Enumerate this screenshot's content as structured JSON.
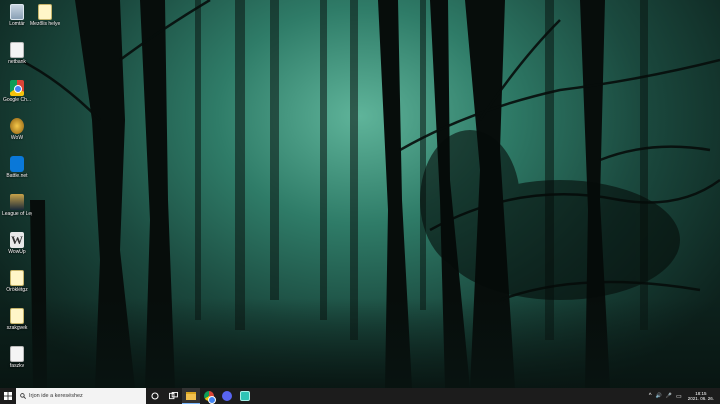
{
  "desktop": {
    "icons": [
      {
        "label": "Lomtár",
        "icon": "recycle-bin-icon"
      },
      {
        "label": "Mezőlis helye",
        "icon": "file-icon"
      },
      {
        "label": "netbank",
        "icon": "file-icon"
      },
      {
        "label": "Google Ch...",
        "icon": "chrome-icon"
      },
      {
        "label": "WoW",
        "icon": "wow-icon"
      },
      {
        "label": "Battle.net",
        "icon": "battlenet-icon"
      },
      {
        "label": "League of Legends",
        "icon": "league-icon"
      },
      {
        "label": "WowUp",
        "icon": "wowup-icon"
      },
      {
        "label": "Öröklétgz",
        "icon": "note-icon"
      },
      {
        "label": "szakgvek",
        "icon": "note-icon"
      },
      {
        "label": "faszkv",
        "icon": "file-icon"
      }
    ]
  },
  "taskbar": {
    "search_placeholder": "Írjon ide a kereséshez",
    "apps": [
      "cortana-icon",
      "task-view-icon",
      "file-explorer-icon",
      "chrome-icon",
      "discord-icon",
      "app-icon"
    ],
    "tray_symbols": [
      "^",
      "🔊",
      "🎤",
      "▭"
    ],
    "time": "18:15",
    "date": "2021. 06. 26."
  },
  "colors": {
    "taskbar": "#1c1c1c",
    "accent": "#7ab8ff",
    "forest": "#2f7c68"
  }
}
